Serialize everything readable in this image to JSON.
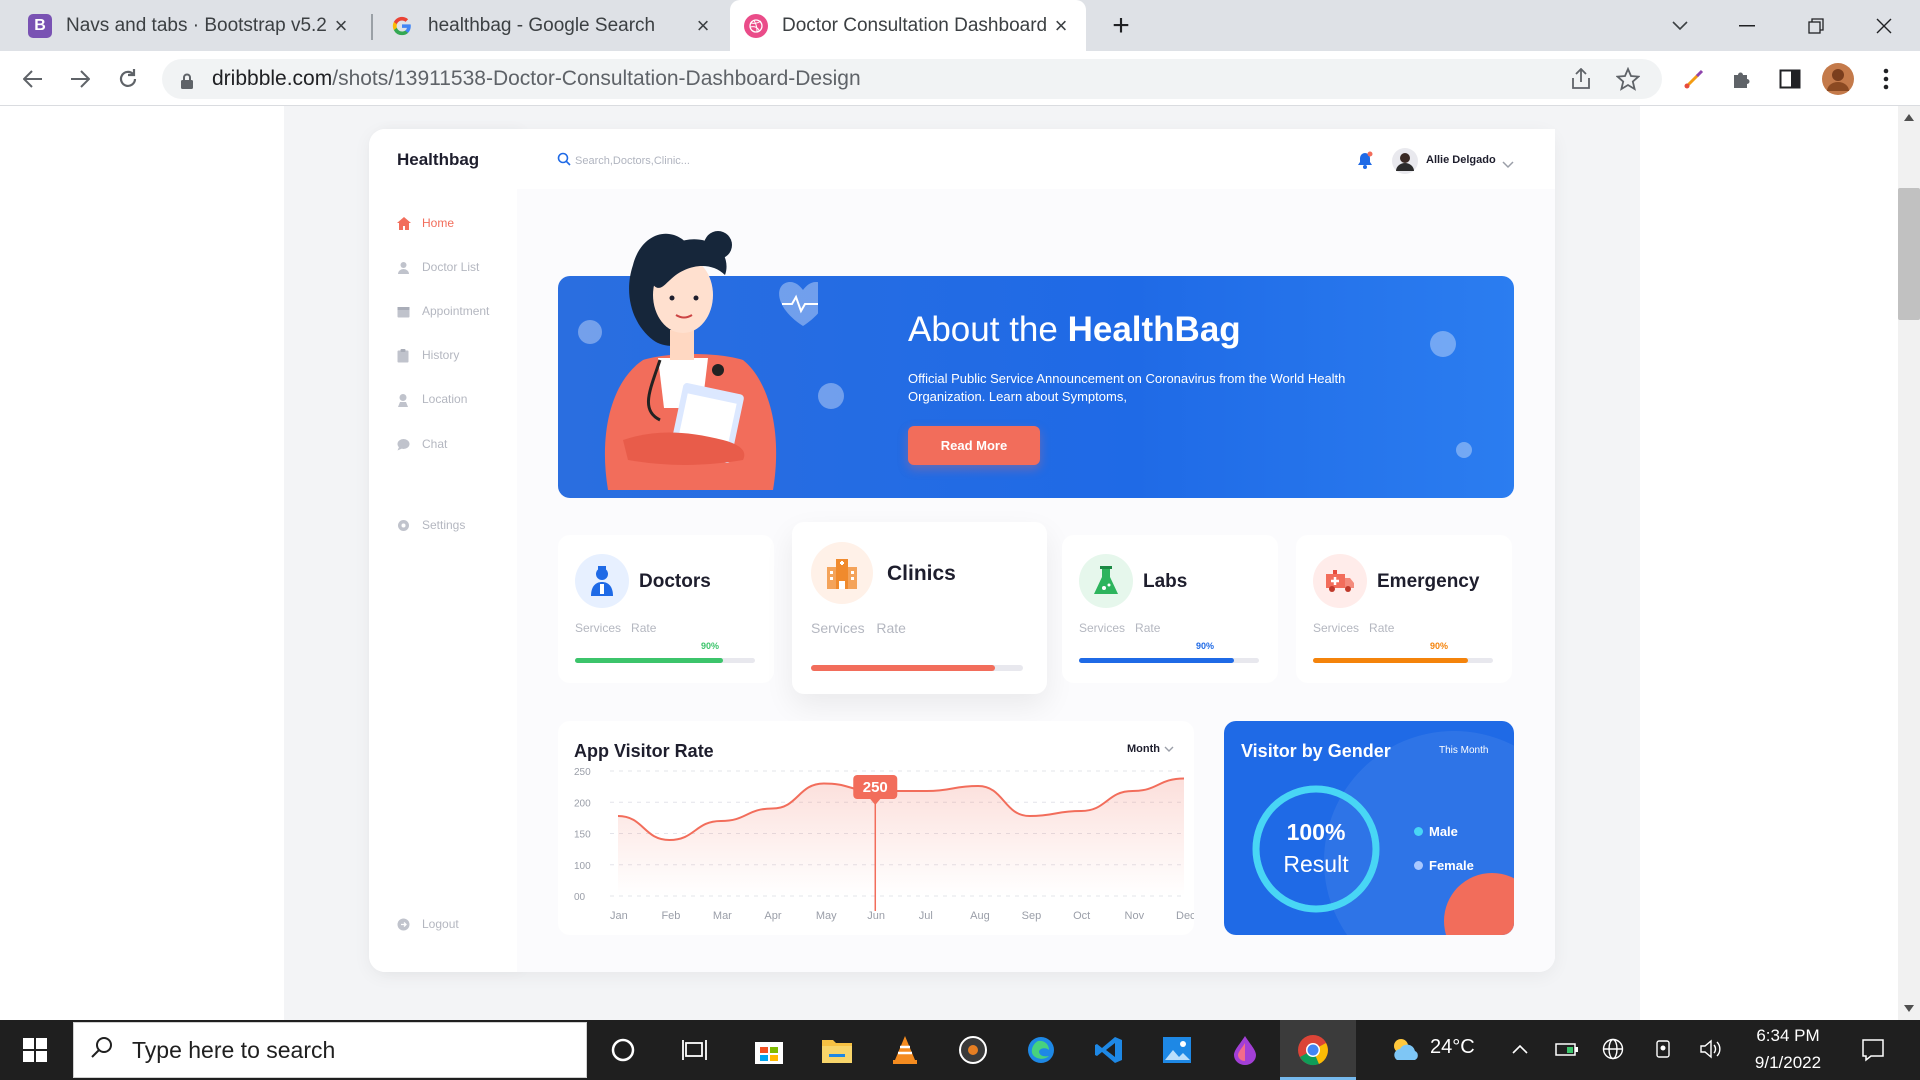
{
  "browser": {
    "tabs": [
      {
        "title": "Navs and tabs · Bootstrap v5.2",
        "favicon": "B",
        "favicon_color": "#7952b3"
      },
      {
        "title": "healthbag - Google Search",
        "favicon": "G",
        "favicon_color": "#4285f4"
      },
      {
        "title": "Doctor Consultation Dashboard",
        "favicon": "dribbble",
        "favicon_color": "#ea4c89"
      }
    ],
    "new_tab_label": "+",
    "url_host": "dribbble.com",
    "url_path": "/shots/13911538-Doctor-Consultation-Dashboard-Design"
  },
  "app": {
    "brand": "Healthbag",
    "search_placeholder": "Search,Doctors,Clinic...",
    "user_name": "Allie Delgado",
    "nav": [
      {
        "label": "Home",
        "icon": "home-icon",
        "active": true
      },
      {
        "label": "Doctor List",
        "icon": "doctor-icon",
        "active": false
      },
      {
        "label": "Appointment",
        "icon": "calendar-icon",
        "active": false
      },
      {
        "label": "History",
        "icon": "clipboard-icon",
        "active": false
      },
      {
        "label": "Location",
        "icon": "location-icon",
        "active": false
      },
      {
        "label": "Chat",
        "icon": "chat-icon",
        "active": false
      }
    ],
    "settings_label": "Settings",
    "logout_label": "Logout",
    "banner": {
      "title_prefix": "About the ",
      "title_bold": "HealthBag",
      "text": "Official Public Service Announcement on Coronavirus from the World Health Organization. Learn about Symptoms,",
      "button": "Read More"
    },
    "stats": [
      {
        "title": "Doctors",
        "sub1": "Services",
        "sub2": "Rate",
        "percent_label": "90%",
        "progress": 0.82,
        "color": "#3cc46b",
        "icon": "doctor-icon"
      },
      {
        "title": "Clinics",
        "sub1": "Services",
        "sub2": "Rate",
        "percent_label": "",
        "progress": 0.87,
        "color": "#f26d5b",
        "icon": "hospital-icon"
      },
      {
        "title": "Labs",
        "sub1": "Services",
        "sub2": "Rate",
        "percent_label": "90%",
        "progress": 0.86,
        "color": "#1f6ae6",
        "icon": "flask-icon"
      },
      {
        "title": "Emergency",
        "sub1": "Services",
        "sub2": "Rate",
        "percent_label": "90%",
        "progress": 0.86,
        "color": "#f4830b",
        "icon": "ambulance-icon"
      }
    ],
    "visitor_chart": {
      "title": "App Visitor Rate",
      "period": "Month"
    },
    "gender": {
      "title": "Visitor by Gender",
      "period": "This Month",
      "value": "100%",
      "result_label": "Result",
      "legend": [
        "Male",
        "Female"
      ]
    }
  },
  "chart_data": {
    "type": "line",
    "categories": [
      "Jan",
      "Feb",
      "Mar",
      "Apr",
      "May",
      "Jun",
      "Jul",
      "Aug",
      "Sep",
      "Oct",
      "Nov",
      "Dec"
    ],
    "yticks": [
      "250",
      "200",
      "150",
      "100",
      "00"
    ],
    "ylim": [
      0,
      250
    ],
    "values": [
      160,
      112,
      150,
      175,
      225,
      210,
      210,
      220,
      160,
      170,
      210,
      235
    ],
    "highlight": {
      "category": "Jun",
      "label": "250"
    },
    "grid": true,
    "color": "#f26d5b"
  },
  "taskbar": {
    "search_placeholder": "Type here to search",
    "weather": "24°C",
    "time": "6:34 PM",
    "date": "9/1/2022"
  }
}
